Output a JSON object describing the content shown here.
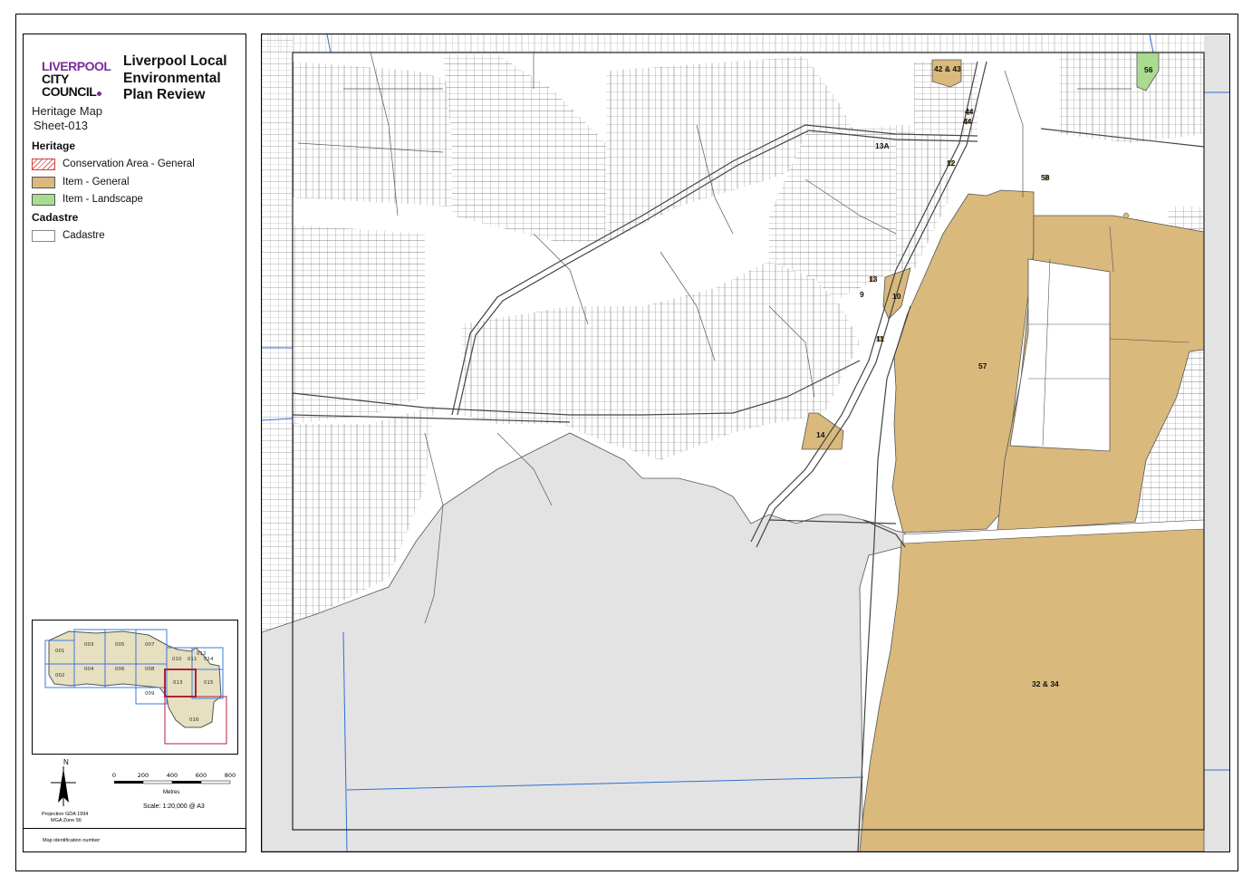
{
  "logo": {
    "line1": "LIVERPOOL",
    "line2": "CITY",
    "line3": "COUNCIL"
  },
  "title": {
    "line1": "Liverpool Local",
    "line2": "Environmental",
    "line3": "Plan Review"
  },
  "map_name": "Heritage Map",
  "sheet_id": "Sheet-013",
  "legend": {
    "heritage_heading": "Heritage",
    "heritage_items": [
      {
        "label": "Conservation Area - General",
        "color": "#e06060"
      },
      {
        "label": "Item - General",
        "color": "#d9b97c"
      },
      {
        "label": "Item - Landscape",
        "color": "#a9dc8f"
      }
    ],
    "cadastre_heading": "Cadastre",
    "cadastre_items": [
      {
        "label": "Cadastre",
        "color": "#ffffff"
      }
    ]
  },
  "overview_sheets": [
    "001",
    "002",
    "003",
    "004",
    "005",
    "006",
    "007",
    "008",
    "009",
    "010",
    "011",
    "012",
    "013",
    "014",
    "015",
    "016"
  ],
  "north_label": "N",
  "scale": {
    "ticks": [
      "0",
      "200",
      "400",
      "600",
      "800"
    ],
    "unit": "Metres",
    "text": "Scale: 1:20,000 @ A3"
  },
  "projection": {
    "line1": "Projection GDA 1994",
    "line2": "MGA Zone 56"
  },
  "map_id_note": "Map identification number:",
  "map_labels": [
    "42 & 43",
    "56",
    "44",
    "44",
    "13A",
    "12",
    "58",
    "13",
    "9",
    "10",
    "11",
    "57",
    "14",
    "32 & 34"
  ],
  "colors": {
    "item_general": "#d9b97c",
    "item_landscape": "#a9dc8f",
    "outside_area": "#e3e3e3",
    "cadastre_line": "#555555",
    "boundary_blue": "#2f6fd6"
  }
}
